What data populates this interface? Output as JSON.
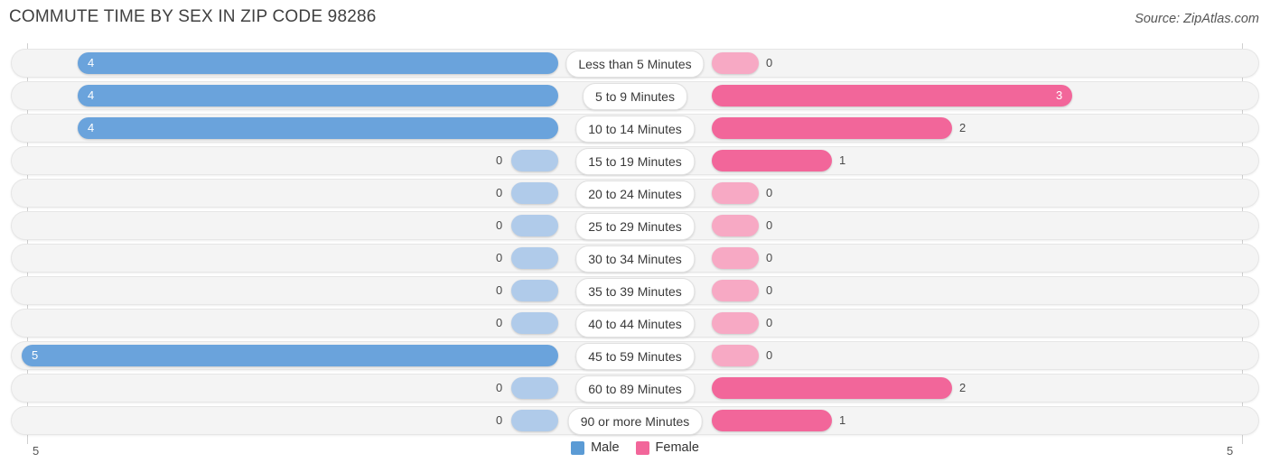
{
  "header": {
    "title": "COMMUTE TIME BY SEX IN ZIP CODE 98286",
    "source": "Source: ZipAtlas.com"
  },
  "legend": {
    "items": [
      {
        "label": "Male",
        "color": "#5b9bd5"
      },
      {
        "label": "Female",
        "color": "#f2669a"
      }
    ]
  },
  "axis": {
    "left_tick": "5",
    "right_tick": "5",
    "max": 5
  },
  "colors": {
    "male": "#6aa3dc",
    "male_zero": "#b0cbea",
    "female": "#f2669a",
    "female_zero": "#f7a9c4",
    "track": "#f4f4f4",
    "track_border": "#e6e6e6"
  },
  "chart_data": {
    "type": "bar",
    "orientation": "horizontal",
    "subtype": "diverging-population-pyramid",
    "title": "COMMUTE TIME BY SEX IN ZIP CODE 98286",
    "xlabel": "",
    "ylabel": "",
    "xlim": [
      5,
      5
    ],
    "grid": false,
    "legend_position": "bottom-center",
    "categories": [
      "Less than 5 Minutes",
      "5 to 9 Minutes",
      "10 to 14 Minutes",
      "15 to 19 Minutes",
      "20 to 24 Minutes",
      "25 to 29 Minutes",
      "30 to 34 Minutes",
      "35 to 39 Minutes",
      "40 to 44 Minutes",
      "45 to 59 Minutes",
      "60 to 89 Minutes",
      "90 or more Minutes"
    ],
    "series": [
      {
        "name": "Male",
        "values": [
          4,
          4,
          4,
          0,
          0,
          0,
          0,
          0,
          0,
          5,
          0,
          0
        ]
      },
      {
        "name": "Female",
        "values": [
          0,
          3,
          2,
          1,
          0,
          0,
          0,
          0,
          0,
          0,
          2,
          1
        ]
      }
    ],
    "male_labels": [
      "4",
      "4",
      "4",
      "0",
      "0",
      "0",
      "0",
      "0",
      "0",
      "5",
      "0",
      "0"
    ],
    "female_labels": [
      "0",
      "3",
      "2",
      "1",
      "0",
      "0",
      "0",
      "0",
      "0",
      "0",
      "2",
      "1"
    ]
  }
}
